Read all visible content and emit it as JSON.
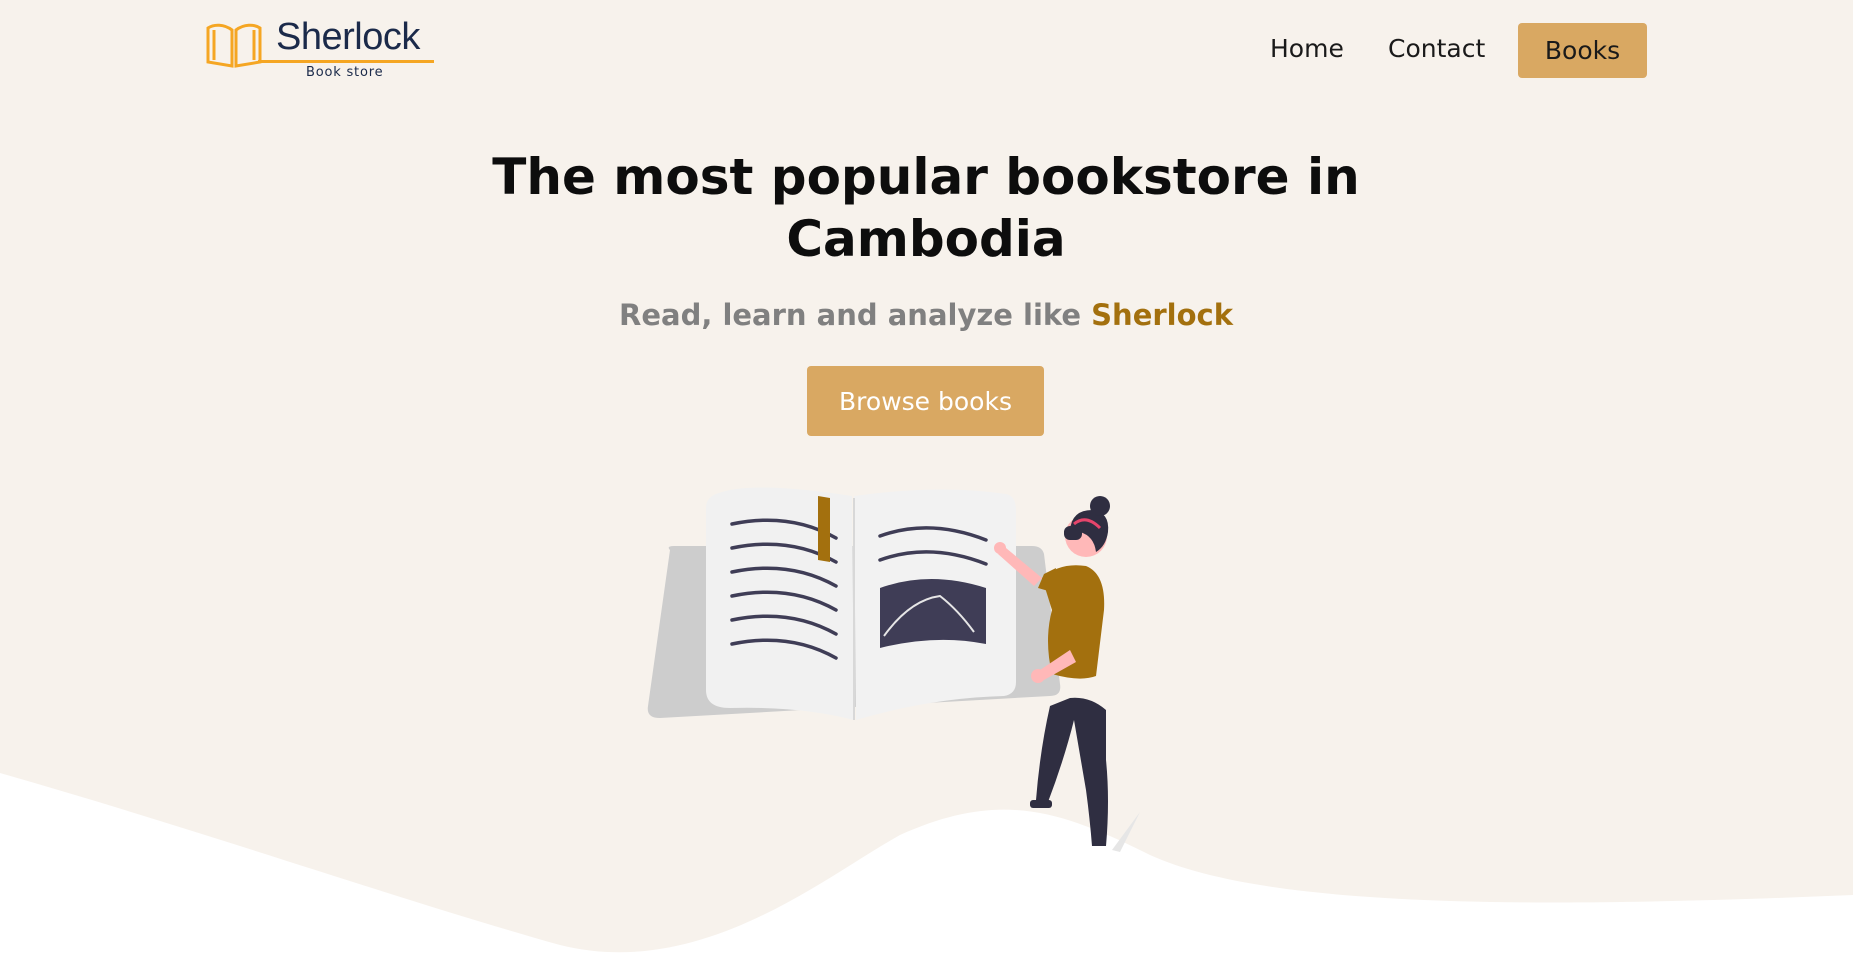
{
  "brand": {
    "name": "Sherlock",
    "subtitle": "Book store"
  },
  "nav": {
    "home": "Home",
    "contact": "Contact",
    "books": "Books"
  },
  "hero": {
    "headline": "The most popular bookstore in Cambodia",
    "tagline_prefix": "Read, learn and analyze like ",
    "tagline_accent": "Sherlock",
    "cta": "Browse books"
  },
  "colors": {
    "background": "#f7f2ec",
    "accent": "#d9a862",
    "accent_text": "#a3700e",
    "logo_orange": "#f5a623",
    "logo_navy": "#1b2a4a"
  },
  "icons": {
    "logo": "open-book-icon",
    "illustration": "woman-reading-book-illustration"
  }
}
